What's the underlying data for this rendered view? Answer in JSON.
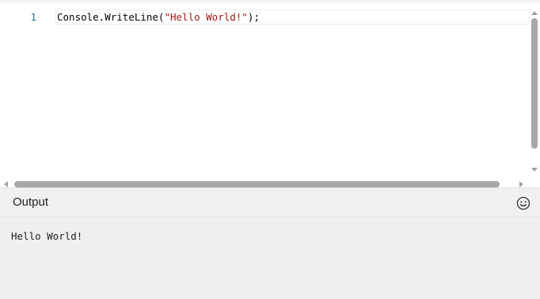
{
  "editor": {
    "lines": [
      {
        "number": "1",
        "tokens": {
          "prefix": "Console.WriteLine(",
          "string": "\"Hello World!\"",
          "suffix": ");"
        }
      }
    ]
  },
  "output": {
    "title": "Output",
    "feedback_icon": "smiley-icon",
    "text": "Hello World!"
  },
  "colors": {
    "line_number": "#237893",
    "string": "#a31515",
    "panel_background": "#efefef",
    "scrollbar_thumb": "#a8a8a8"
  }
}
